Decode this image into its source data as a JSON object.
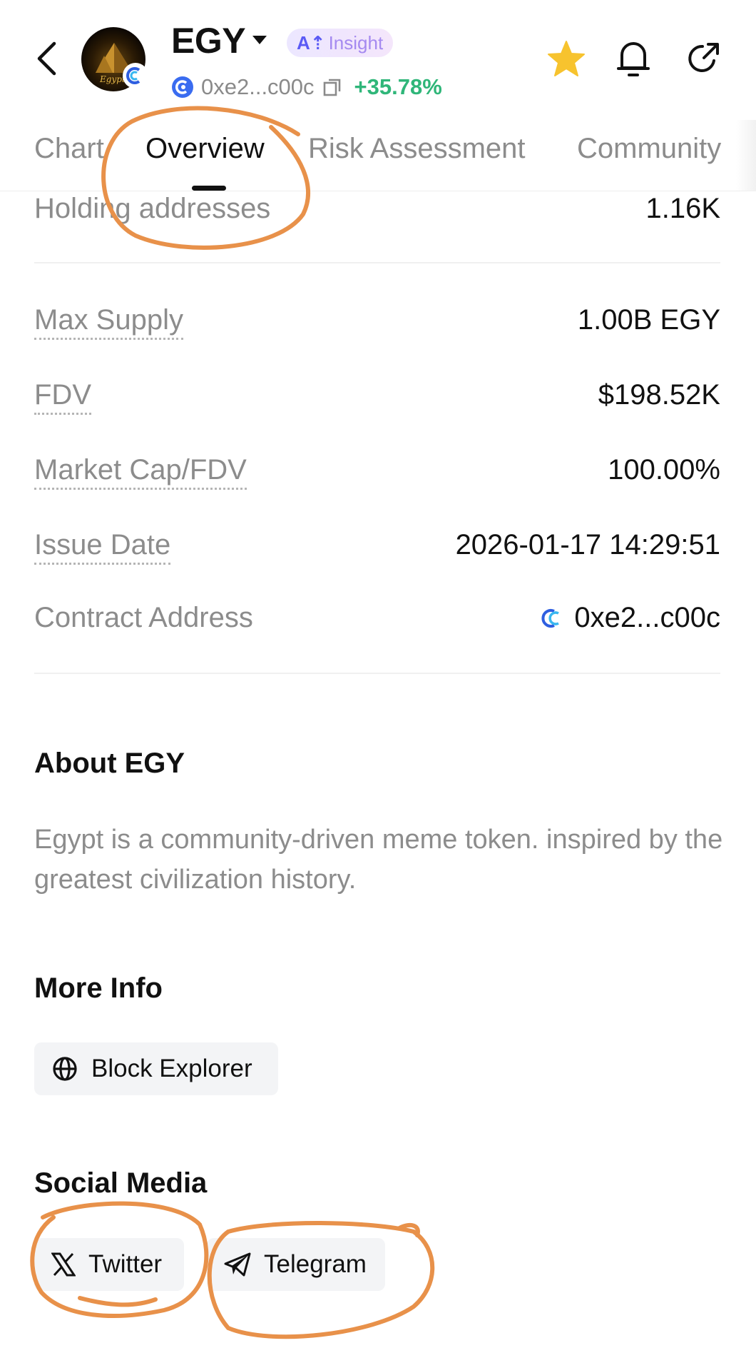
{
  "header": {
    "symbol": "EGY",
    "logo_text": "Egypt",
    "ai_mark": "A⇡",
    "ai_label": "Insight",
    "address": "0xe2...c00c",
    "change": "+35.78%",
    "icons": [
      "back-arrow-icon",
      "chain-icon",
      "caret-down-icon",
      "copy-icon",
      "star-icon",
      "bell-icon",
      "share-icon"
    ],
    "colors": {
      "positive": "#2fb679",
      "star": "#f7c32e",
      "ai_accent": "#5b5bf5"
    }
  },
  "tabs": [
    {
      "label": "Chart"
    },
    {
      "label": "Overview"
    },
    {
      "label": "Risk Assessment"
    },
    {
      "label": "Community"
    }
  ],
  "stats": {
    "holding": {
      "label": "Holding addresses",
      "value": "1.16K"
    },
    "max_supply": {
      "label": "Max Supply",
      "value": "1.00B EGY"
    },
    "fdv": {
      "label": "FDV",
      "value": "$198.52K"
    },
    "mcap_fdv": {
      "label": "Market Cap/FDV",
      "value": "100.00%"
    },
    "issue_date": {
      "label": "Issue Date",
      "value": "2026-01-17 14:29:51"
    },
    "contract": {
      "label": "Contract Address",
      "value": "0xe2...c00c"
    }
  },
  "about": {
    "title": "About EGY",
    "text": "Egypt is a community-driven meme token. inspired by the greatest civilization history."
  },
  "more_info": {
    "title": "More Info",
    "block_explorer": "Block Explorer"
  },
  "social": {
    "title": "Social Media",
    "twitter": "Twitter",
    "telegram": "Telegram"
  },
  "annotation_color": "#e8914a"
}
